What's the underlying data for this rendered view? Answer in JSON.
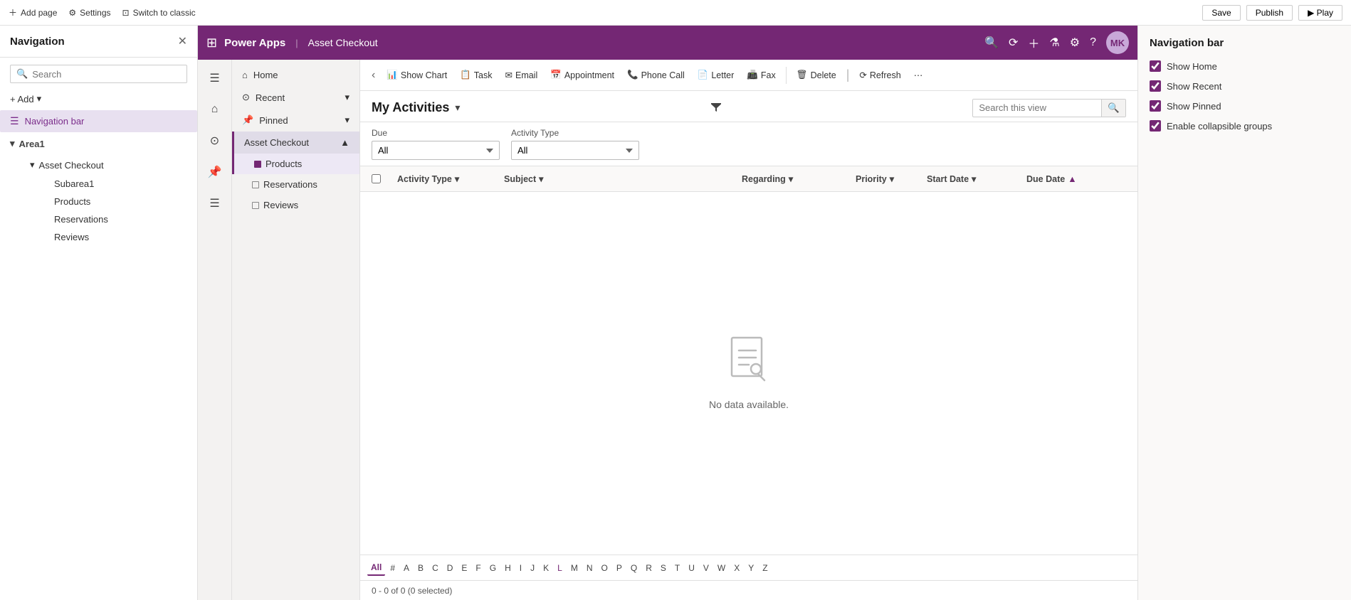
{
  "topbar": {
    "add_page": "Add page",
    "settings": "Settings",
    "switch_classic": "Switch to classic"
  },
  "left_panel": {
    "title": "Navigation",
    "search_placeholder": "Search",
    "add_label": "+ Add",
    "nav_bar_label": "Navigation bar",
    "area1_label": "Area1",
    "asset_checkout_label": "Asset Checkout",
    "subarea1_label": "Subarea1",
    "products_label": "Products",
    "reservations_label": "Reservations",
    "reviews_label": "Reviews"
  },
  "app_header": {
    "logo": "Power Apps",
    "app_name": "Asset Checkout",
    "avatar_initials": "MK"
  },
  "nav_list": {
    "home": "Home",
    "recent": "Recent",
    "pinned": "Pinned",
    "asset_checkout": "Asset Checkout",
    "products": "Products",
    "reservations": "Reservations",
    "reviews": "Reviews"
  },
  "toolbar": {
    "back": "‹",
    "show_chart": "Show Chart",
    "task": "Task",
    "email": "Email",
    "appointment": "Appointment",
    "phone_call": "Phone Call",
    "letter": "Letter",
    "fax": "Fax",
    "delete": "Delete",
    "refresh": "Refresh",
    "more": "⋯"
  },
  "view": {
    "title": "My Activities",
    "filter_due_label": "Due",
    "filter_due_value": "All",
    "filter_activity_type_label": "Activity Type",
    "filter_activity_type_value": "All",
    "search_placeholder": "Search this view",
    "col_activity_type": "Activity Type",
    "col_subject": "Subject",
    "col_regarding": "Regarding",
    "col_priority": "Priority",
    "col_start_date": "Start Date",
    "col_due_date": "Due Date",
    "empty_text": "No data available.",
    "status": "0 - 0 of 0 (0 selected)"
  },
  "alphabet": [
    "All",
    "#",
    "A",
    "B",
    "C",
    "D",
    "E",
    "F",
    "G",
    "H",
    "I",
    "J",
    "K",
    "L",
    "M",
    "N",
    "O",
    "P",
    "Q",
    "R",
    "S",
    "T",
    "U",
    "V",
    "W",
    "X",
    "Y",
    "Z"
  ],
  "right_panel": {
    "title": "Navigation bar",
    "show_home": "Show Home",
    "show_recent": "Show Recent",
    "show_pinned": "Show Pinned",
    "enable_collapsible": "Enable collapsible groups"
  },
  "colors": {
    "accent": "#742774",
    "accent_light": "#e8e0f0"
  }
}
